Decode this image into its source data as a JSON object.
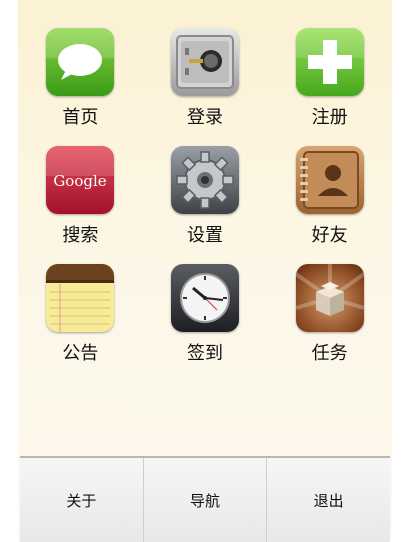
{
  "grid": {
    "items": [
      {
        "label": "首页",
        "icon": "message-bubble-icon"
      },
      {
        "label": "登录",
        "icon": "safe-lock-icon"
      },
      {
        "label": "注册",
        "icon": "plus-icon"
      },
      {
        "label": "搜索",
        "icon": "google-icon",
        "icon_text": "Google"
      },
      {
        "label": "设置",
        "icon": "gear-icon"
      },
      {
        "label": "好友",
        "icon": "contacts-book-icon"
      },
      {
        "label": "公告",
        "icon": "notepad-icon"
      },
      {
        "label": "签到",
        "icon": "clock-icon"
      },
      {
        "label": "任务",
        "icon": "package-box-icon"
      }
    ]
  },
  "bottom_bar": {
    "about": "关于",
    "navigate": "导航",
    "exit": "退出"
  }
}
